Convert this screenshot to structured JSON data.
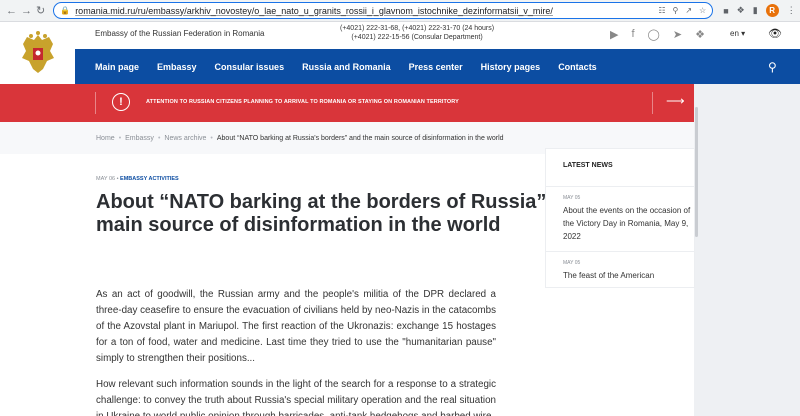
{
  "browser": {
    "url": "romania.mid.ru/ru/embassy/arkhiv_novostey/o_lae_nato_u_granits_rossii_i_glavnom_istochnike_dezinformatsii_v_mire/",
    "profile_letter": "R"
  },
  "header": {
    "site_name": "Embassy of the Russian Federation in Romania",
    "phone_line1": "(+4021) 222-31-68, (+4021) 222-31-70 (24 hours)",
    "phone_line2": "(+4021) 222-15-56 (Consular Department)",
    "language": "en",
    "logo_icon": "coat-of-arms"
  },
  "nav": {
    "items": [
      "Main page",
      "Embassy",
      "Consular issues",
      "Russia and Romania",
      "Press center",
      "History pages",
      "Contacts"
    ]
  },
  "alert": {
    "message": "ATTENTION TO RUSSIAN CITIZENS PLANNING TO ARRIVAL TO ROMANIA OR STAYING ON ROMANIAN TERRITORY"
  },
  "breadcrumb": {
    "items": [
      "Home",
      "Embassy",
      "News archive"
    ],
    "current": "About “NATO barking at Russia's borders” and the main source of disinformation in the world"
  },
  "article": {
    "date": "MAY 06",
    "category": "EMBASSY ACTIVITIES",
    "title": "About “NATO barking at the borders of Russia” and the main source of disinformation in the world",
    "paragraph1": "As an act of goodwill, the Russian army and the people's militia of the DPR declared a three-day ceasefire to ensure the evacuation of civilians held by neo-Nazis in the catacombs of the Azovstal plant in Mariupol. The first reaction of the Ukronazis: exchange 15 hostages for a ton of food, water and medicine. Last time they tried to use the \"humanitarian pause\" simply to strengthen their positions...",
    "paragraph2": "How relevant such information sounds in the light of the search for a response to a strategic challenge: to convey the truth about Russia's special military operation and the real situation in Ukraine to world public opinion through barricades, anti-tank hedgehogs and barbed wire"
  },
  "sidebar": {
    "heading": "LATEST NEWS",
    "news": [
      {
        "date": "MAY 05",
        "text": "About the events on the occasion of the Victory Day in Romania, May 9, 2022"
      },
      {
        "date": "MAY 05",
        "text": "The feast of the American"
      }
    ]
  }
}
